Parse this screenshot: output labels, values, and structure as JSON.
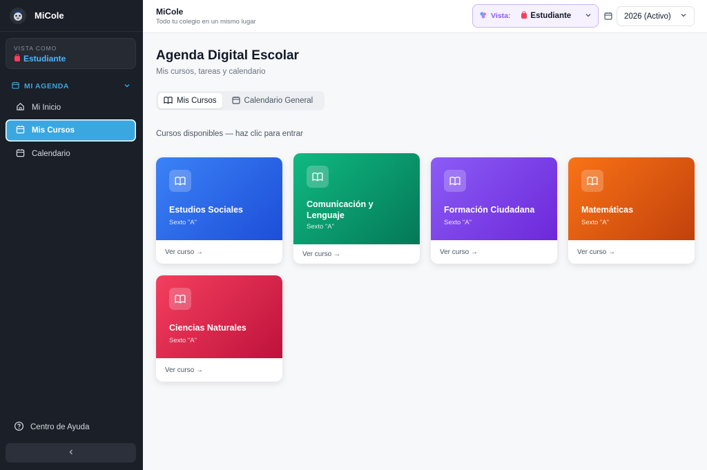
{
  "app": {
    "name": "MiCole",
    "subtitle": "Todo tu colegio en un mismo lugar"
  },
  "sidebar": {
    "brand": "MiCole",
    "view_as_label": "VISTA COMO",
    "view_as_value": "Estudiante",
    "section": "MI AGENDA",
    "items": [
      {
        "label": "Mi Inicio"
      },
      {
        "label": "Mis Cursos"
      },
      {
        "label": "Calendario"
      }
    ],
    "help": "Centro de Ayuda"
  },
  "header": {
    "vista_label": "Vista:",
    "vista_value": "Estudiante",
    "year": "2026 (Activo)"
  },
  "main": {
    "title": "Agenda Digital Escolar",
    "subtitle": "Mis cursos, tareas y calendario",
    "tabs": [
      {
        "label": "Mis Cursos"
      },
      {
        "label": "Calendario General"
      }
    ],
    "hint": "Cursos disponibles — haz clic para entrar",
    "courses": [
      {
        "name": "Estudios Sociales",
        "grade": "Sexto \"A\"",
        "link": "Ver curso →"
      },
      {
        "name": "Comunicación y Lenguaje",
        "grade": "Sexto \"A\"",
        "link": "Ver curso →"
      },
      {
        "name": "Formación Ciudadana",
        "grade": "Sexto \"A\"",
        "link": "Ver curso →"
      },
      {
        "name": "Matemáticas",
        "grade": "Sexto \"A\"",
        "link": "Ver curso →"
      },
      {
        "name": "Ciencias Naturales",
        "grade": "Sexto \"A\"",
        "link": "Ver curso →"
      }
    ]
  },
  "colors": {
    "sidebar_bg": "#1b1f27",
    "accent": "#3aa7e0",
    "course_blue": "#2f6ff0",
    "course_green": "#0fa56e",
    "course_purple": "#7c3aed",
    "course_orange": "#ea6a12",
    "course_red": "#e11d48"
  }
}
